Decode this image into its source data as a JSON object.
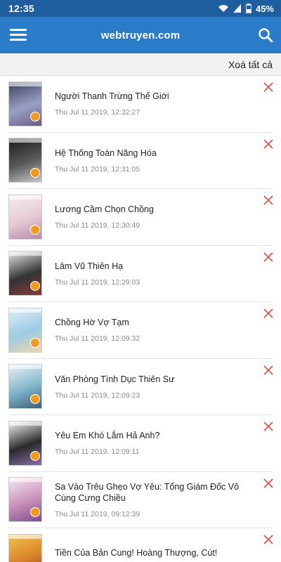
{
  "status_bar": {
    "time": "12:35",
    "battery": "45%"
  },
  "app_bar": {
    "title": "webtruyen.com",
    "menu_icon": "hamburger-menu-icon",
    "search_icon": "search-icon"
  },
  "actions": {
    "clear_all": "Xoá tất cả"
  },
  "colors": {
    "status_bar": "#1f5fa0",
    "app_bar": "#2a7bc8",
    "remove_icon": "#e2473a"
  },
  "history": [
    {
      "title": "Người Thanh Trừng Thế Giới",
      "time": "Thu Jul 11 2019, 12:32:27",
      "cover_colors": [
        "#3a3f5c",
        "#9aa0c4",
        "#6b5b8a"
      ]
    },
    {
      "title": "Hệ Thống Toàn Năng Hóa",
      "time": "Thu Jul 11 2019, 12:31:05",
      "cover_colors": [
        "#1c1c1c",
        "#5a5a5a",
        "#c9c9c9"
      ]
    },
    {
      "title": "Lương Cầm Chọn Chồng",
      "time": "Thu Jul 11 2019, 12:30:49",
      "cover_colors": [
        "#f4eef0",
        "#e6c8d4",
        "#b98aa6"
      ]
    },
    {
      "title": "Lâm Vũ Thiên Hạ",
      "time": "Thu Jul 11 2019, 12:29:03",
      "cover_colors": [
        "#e9e9e9",
        "#333333",
        "#8a3b3b"
      ]
    },
    {
      "title": "Chồng Hờ Vợ Tạm",
      "time": "Thu Jul 11 2019, 12:09:32",
      "cover_colors": [
        "#dfeef7",
        "#9ccbe3",
        "#f0d7b0"
      ]
    },
    {
      "title": "Văn Phòng Tình Dục Thiên Sư",
      "time": "Thu Jul 11 2019, 12:09:23",
      "cover_colors": [
        "#eaf3f6",
        "#7fb5c9",
        "#3b5f7a"
      ]
    },
    {
      "title": "Yêu Em Khó Lắm Hả Anh?",
      "time": "Thu Jul 11 2019, 12:09:11",
      "cover_colors": [
        "#f4f4f4",
        "#2a2a2a",
        "#8c6fb0"
      ]
    },
    {
      "title": "Sa Vào Trêu Ghẹo Vợ Yêu: Tổng Giám Đốc Vô Cùng Cưng Chiều",
      "time": "Thu Jul 11 2019, 09:12:39",
      "cover_colors": [
        "#f6e8f0",
        "#c98fb8",
        "#7a4f8e"
      ]
    },
    {
      "title": "Tiền Của Bản Cung! Hoàng Thượng, Cút!",
      "time": "",
      "cover_colors": [
        "#f3c24a",
        "#d9822b",
        "#7a3b1c"
      ]
    }
  ]
}
